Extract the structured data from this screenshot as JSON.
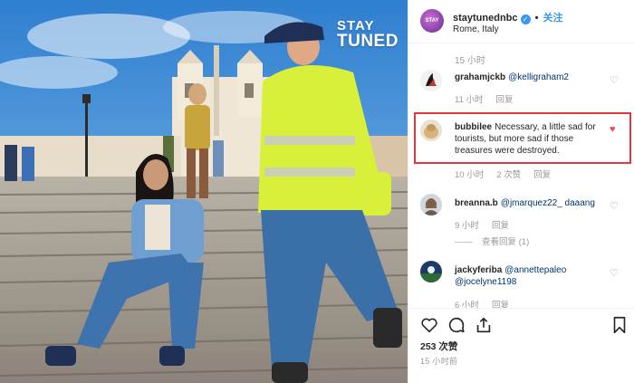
{
  "watermark": {
    "line1": "STAY",
    "line2": "TUNED"
  },
  "header": {
    "username": "staytunednbc",
    "follow_label": "关注",
    "dot": "•",
    "location": "Rome, Italy",
    "avatar_text": "STAY TUNED"
  },
  "comments": {
    "top_time": "15 小时",
    "items": [
      {
        "user": "grahamjckb",
        "text": "@kelligraham2",
        "time": "11 小时",
        "reply": "回复",
        "likes": "",
        "liked": false
      },
      {
        "user": "bubbilee",
        "text": "Necessary, a little sad for tourists, but more sad if those treasures were destroyed.",
        "time": "10 小时",
        "likes": "2 次赞",
        "reply": "回复",
        "liked": true
      },
      {
        "user": "breanna.b",
        "text": "@jmarquez22_ daaang",
        "time": "9 小时",
        "reply": "回复",
        "likes": "",
        "liked": false,
        "view_replies": "查看回复 (1)"
      },
      {
        "user": "jackyferiba",
        "text": "@annettepaleo @jocelyne1198",
        "time": "6 小时",
        "reply": "回复",
        "likes": "",
        "liked": false
      }
    ]
  },
  "actions": {
    "like_icon": "heart-icon",
    "comment_icon": "comment-icon",
    "share_icon": "share-icon",
    "save_icon": "bookmark-icon",
    "likes_count": "253 次赞",
    "posted_time": "15 小时前"
  },
  "colors": {
    "accent_blue": "#3897f0",
    "liked_red": "#ed4956",
    "highlight_red": "#e0383e",
    "meta_gray": "#999999",
    "vest_yellow": "#d8f03a"
  }
}
